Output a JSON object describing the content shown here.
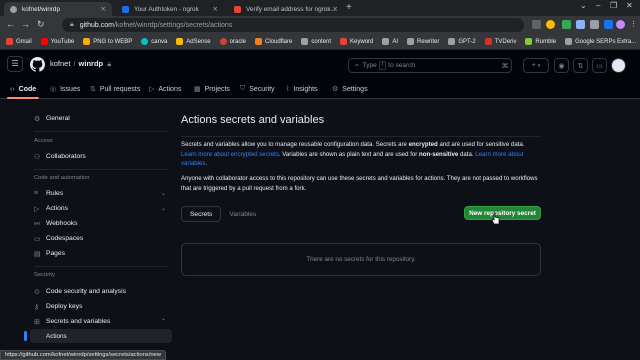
{
  "browser": {
    "tabs": [
      {
        "title": "kofnet/winrdp",
        "active": true,
        "favicon_color": "#9aa0a6"
      },
      {
        "title": "Your Authtoken - ngrok",
        "active": false,
        "favicon_color": "#1f6feb"
      },
      {
        "title": "Verify email address for ngrok...",
        "active": false,
        "favicon_color": "#ea4335"
      }
    ],
    "url_domain": "github.com",
    "url_path": "/kofnet/winrdp/settings/secrets/actions",
    "bookmarks": [
      {
        "label": "Gmail",
        "color": "#ea4335"
      },
      {
        "label": "YouTube",
        "color": "#ff0000"
      },
      {
        "label": "PNG to WEBP",
        "color": "#f9ab00"
      },
      {
        "label": "canva",
        "color": "#00c4cc"
      },
      {
        "label": "AdSense",
        "color": "#fbbc04"
      },
      {
        "label": "oracle",
        "color": "#c74634"
      },
      {
        "label": "Cloudflare",
        "color": "#f38020"
      },
      {
        "label": "content",
        "color": "#9aa0a6"
      },
      {
        "label": "Keyword",
        "color": "#e94235"
      },
      {
        "label": "AI",
        "color": "#9aa0a6"
      },
      {
        "label": "Rewriter",
        "color": "#9aa0a6"
      },
      {
        "label": "GPT-2",
        "color": "#9aa0a6"
      },
      {
        "label": "TVDeriv",
        "color": "#d93025"
      },
      {
        "label": "Rumble",
        "color": "#85c742"
      },
      {
        "label": "Google SERPs Extra...",
        "color": "#9aa0a6"
      }
    ],
    "status_url": "https://github.com/kofnet/winrdp/settings/secrets/actions/new"
  },
  "header": {
    "owner": "kofnet",
    "repo": "winrdp",
    "search_prefix": "Type",
    "search_key": "/",
    "search_suffix": "to search"
  },
  "repo_nav": [
    {
      "label": "Code",
      "icon": "code-icon",
      "glyph": "‹›",
      "selected": true
    },
    {
      "label": "Issues",
      "icon": "issue-icon",
      "glyph": "◎",
      "selected": false
    },
    {
      "label": "Pull requests",
      "icon": "pull-request-icon",
      "glyph": "⇅",
      "selected": false
    },
    {
      "label": "Actions",
      "icon": "play-icon",
      "glyph": "▷",
      "selected": false
    },
    {
      "label": "Projects",
      "icon": "table-icon",
      "glyph": "▦",
      "selected": false
    },
    {
      "label": "Security",
      "icon": "shield-icon",
      "glyph": "⛉",
      "selected": false
    },
    {
      "label": "Insights",
      "icon": "graph-icon",
      "glyph": "⌇",
      "selected": false
    },
    {
      "label": "Settings",
      "icon": "gear-icon",
      "glyph": "⚙",
      "selected": false
    }
  ],
  "sidebar": {
    "general": "General",
    "access_heading": "Access",
    "collaborators": "Collaborators",
    "code_heading": "Code and automation",
    "rules": "Rules",
    "actions": "Actions",
    "webhooks": "Webhooks",
    "codespaces": "Codespaces",
    "pages": "Pages",
    "security_heading": "Security",
    "code_security": "Code security and analysis",
    "deploy_keys": "Deploy keys",
    "secrets_variables": "Secrets and variables",
    "sub_actions": "Actions"
  },
  "main": {
    "title": "Actions secrets and variables",
    "p1": {
      "t1": "Secrets and variables allow you to manage reusable configuration data. Secrets are ",
      "b1": "encrypted",
      "t2": " and are used for sensitive data. ",
      "link1": "Learn more about encrypted secrets",
      "t3": ". Variables are shown as plain text and are used for ",
      "b2": "non-sensitive",
      "t4": " data. ",
      "link2": "Learn more about variables",
      "t5": "."
    },
    "p2": "Anyone with collaborator access to this repository can use these secrets and variables for actions. They are not passed to workflows that are triggered by a pull request from a fork.",
    "tab_secrets": "Secrets",
    "tab_variables": "Variables",
    "new_secret_button": "New repository secret",
    "empty_message": "There are no secrets for this repository."
  }
}
